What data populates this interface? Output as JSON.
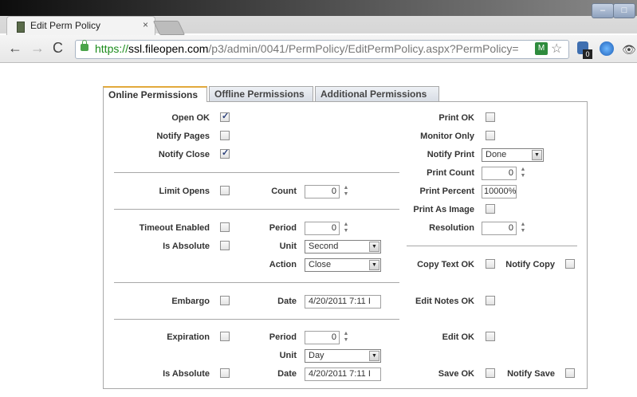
{
  "browser": {
    "tab_title": "Edit Perm Policy",
    "tab_close": "×",
    "url_proto": "https://",
    "url_host": "ssl.fileopen.com",
    "url_path": "/p3/admin/0041/PermPolicy/EditPermPolicy.aspx?PermPolicy=",
    "ext_badge": "0"
  },
  "tabs": [
    {
      "label": "Online Permissions",
      "active": true
    },
    {
      "label": "Offline Permissions",
      "active": false
    },
    {
      "label": "Additional Permissions",
      "active": false
    }
  ],
  "form": {
    "open_ok": {
      "label": "Open OK",
      "checked": true
    },
    "notify_pages": {
      "label": "Notify Pages",
      "checked": false
    },
    "notify_close": {
      "label": "Notify Close",
      "checked": true
    },
    "limit_opens": {
      "label": "Limit Opens",
      "checked": false
    },
    "count": {
      "label": "Count",
      "value": "0"
    },
    "timeout_enabled": {
      "label": "Timeout Enabled",
      "checked": false
    },
    "timeout_period": {
      "label": "Period",
      "value": "0"
    },
    "timeout_is_absolute": {
      "label": "Is Absolute",
      "checked": false
    },
    "timeout_unit": {
      "label": "Unit",
      "value": "Second"
    },
    "timeout_action": {
      "label": "Action",
      "value": "Close"
    },
    "embargo": {
      "label": "Embargo",
      "checked": false
    },
    "embargo_date": {
      "label": "Date",
      "value": "4/20/2011 7:11 I"
    },
    "expiration": {
      "label": "Expiration",
      "checked": false
    },
    "expiration_period": {
      "label": "Period",
      "value": "0"
    },
    "expiration_unit": {
      "label": "Unit",
      "value": "Day"
    },
    "expiration_is_absolute": {
      "label": "Is Absolute",
      "checked": false
    },
    "expiration_date": {
      "label": "Date",
      "value": "4/20/2011 7:11 I"
    },
    "print_ok": {
      "label": "Print OK",
      "checked": false
    },
    "monitor_only": {
      "label": "Monitor Only",
      "checked": false
    },
    "notify_print": {
      "label": "Notify Print",
      "value": "Done"
    },
    "print_count": {
      "label": "Print Count",
      "value": "0"
    },
    "print_percent": {
      "label": "Print Percent",
      "value": "10000%"
    },
    "print_as_image": {
      "label": "Print As Image",
      "checked": false
    },
    "resolution": {
      "label": "Resolution",
      "value": "0"
    },
    "copy_text_ok": {
      "label": "Copy Text OK",
      "checked": false
    },
    "notify_copy": {
      "label": "Notify Copy",
      "checked": false
    },
    "edit_notes_ok": {
      "label": "Edit Notes OK",
      "checked": false
    },
    "edit_ok": {
      "label": "Edit OK",
      "checked": false
    },
    "save_ok": {
      "label": "Save OK",
      "checked": false
    },
    "notify_save": {
      "label": "Notify Save",
      "checked": false
    }
  }
}
